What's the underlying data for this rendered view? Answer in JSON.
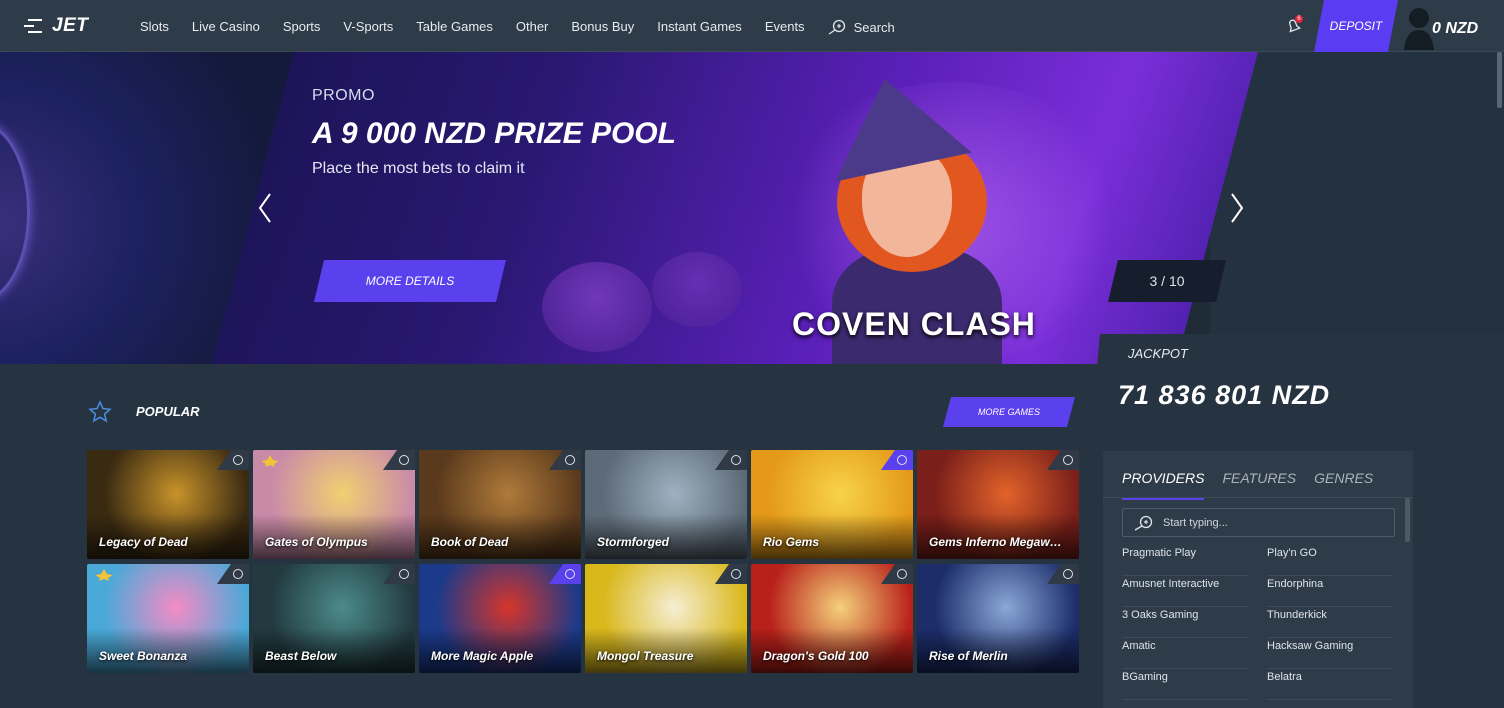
{
  "header": {
    "logo": "JET",
    "nav": [
      "Slots",
      "Live Casino",
      "Sports",
      "V-Sports",
      "Table Games",
      "Other",
      "Bonus Buy",
      "Instant Games",
      "Events"
    ],
    "search_label": "Search",
    "notification_count": "6",
    "deposit_label": "DEPOSIT",
    "balance": "0 NZD"
  },
  "banner": {
    "label": "PROMO",
    "title": "A 9 000 NZD PRIZE POOL",
    "subtitle": "Place the most bets to claim it",
    "button": "MORE DETAILS",
    "game_title": "COVEN CLASH",
    "counter": "3 / 10"
  },
  "jackpot": {
    "label": "JACKPOT",
    "value": "71 836 801 NZD"
  },
  "popular": {
    "label": "POPULAR",
    "more_games": "MORE GAMES",
    "games": [
      {
        "name": "Legacy of Dead",
        "bg": "#3a2a12",
        "accent": "#c8932a"
      },
      {
        "name": "Gates of Olympus",
        "bg": "#c98aa8",
        "accent": "#f1d070"
      },
      {
        "name": "Book of Dead",
        "bg": "#5a3a1c",
        "accent": "#b07a3a"
      },
      {
        "name": "Stormforged",
        "bg": "#5d6b78",
        "accent": "#9fb1c1"
      },
      {
        "name": "Rio Gems",
        "bg": "#e49a18",
        "accent": "#f7d34a"
      },
      {
        "name": "Gems Inferno Megaw…",
        "bg": "#7a1f1a",
        "accent": "#e3632a"
      },
      {
        "name": "Sweet Bonanza",
        "bg": "#4aa9d8",
        "accent": "#f58bc5"
      },
      {
        "name": "Beast Below",
        "bg": "#223a40",
        "accent": "#4c8b8a"
      },
      {
        "name": "More Magic Apple",
        "bg": "#1b3a8a",
        "accent": "#d6352a"
      },
      {
        "name": "Mongol Treasure",
        "bg": "#d9b81c",
        "accent": "#f6eed4"
      },
      {
        "name": "Dragon's Gold 100",
        "bg": "#b8201a",
        "accent": "#f4d17a"
      },
      {
        "name": "Rise of Merlin",
        "bg": "#1c2d6a",
        "accent": "#8aa7d8"
      }
    ]
  },
  "providers": {
    "tabs": [
      "PROVIDERS",
      "FEATURES",
      "GENRES"
    ],
    "search_placeholder": "Start typing...",
    "left": [
      "Pragmatic Play",
      "Amusnet Interactive",
      "3 Oaks Gaming",
      "Amatic",
      "BGaming"
    ],
    "right": [
      "Play'n GO",
      "Endorphina",
      "Thunderkick",
      "Hacksaw Gaming",
      "Belatra"
    ]
  },
  "colors": {
    "accent": "#5b41ee",
    "header_bg": "#2e3c49",
    "page_bg": "#263340"
  }
}
